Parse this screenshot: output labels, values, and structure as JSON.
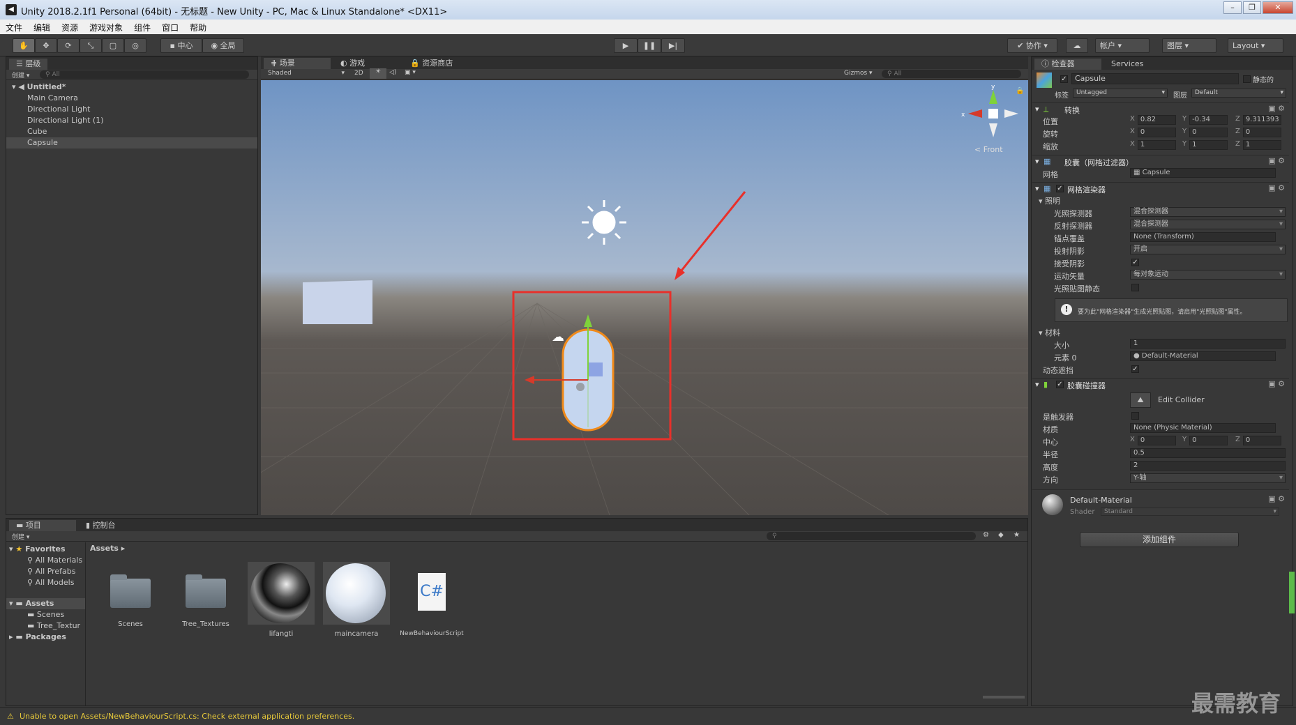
{
  "window": {
    "title": "Unity 2018.2.1f1 Personal (64bit) - 无标题 - New Unity - PC, Mac & Linux Standalone* <DX11>",
    "logo": "◀",
    "min": "–",
    "max": "❐",
    "close": "✕"
  },
  "menu": [
    "文件",
    "编辑",
    "资源",
    "游戏对象",
    "组件",
    "窗口",
    "帮助"
  ],
  "toolbar": {
    "center": "中心",
    "global": "全局",
    "collab": "协作",
    "account": "帐户",
    "layers": "图层",
    "layout": "Layout"
  },
  "hierarchy": {
    "tab": "层级",
    "create": "创建",
    "search": "All",
    "scene": "Untitled*",
    "items": [
      "Main Camera",
      "Directional Light",
      "Directional Light (1)",
      "Cube",
      "Capsule"
    ],
    "selected": 4
  },
  "sceneview": {
    "tabs": [
      "场景",
      "游戏",
      "资源商店"
    ],
    "shading": "Shaded",
    "mode2d": "2D",
    "gizmos": "Gizmos",
    "search": "All",
    "orientation": "Front"
  },
  "inspector": {
    "tabs": [
      "检查器",
      "Services"
    ],
    "object_name": "Capsule",
    "static": "静态的",
    "tag_label": "标签",
    "tag": "Untagged",
    "layer_label": "图层",
    "layer": "Default",
    "transform": {
      "title": "转换",
      "position": {
        "label": "位置",
        "x": "0.82",
        "y": "-0.34",
        "z": "9.311393"
      },
      "rotation": {
        "label": "旋转",
        "x": "0",
        "y": "0",
        "z": "0"
      },
      "scale": {
        "label": "缩放",
        "x": "1",
        "y": "1",
        "z": "1"
      }
    },
    "meshfilter": {
      "title": "胶囊（网格过滤器）",
      "mesh_label": "网格",
      "mesh": "Capsule"
    },
    "renderer": {
      "title": "网格渲染器",
      "lighting": "照明",
      "rows": [
        {
          "label": "光照探测器",
          "value": "混合探测器"
        },
        {
          "label": "反射探测器",
          "value": "混合探测器"
        },
        {
          "label": "锚点覆盖",
          "value": "None (Transform)"
        },
        {
          "label": "投射阴影",
          "value": "开启"
        }
      ],
      "receive": "接受阴影",
      "motion_label": "运动矢量",
      "motion": "每对象运动",
      "static_lightmap": "光照贴图静态",
      "info": "要为此\"网格渲染器\"生成光照贴图，请启用\"光照贴图\"属性。",
      "materials": "材料",
      "size_label": "大小",
      "size": "1",
      "element_label": "元素 0",
      "element": "Default-Material",
      "dynamic": "动态遮挡"
    },
    "collider": {
      "title": "胶囊碰撞器",
      "edit": "Edit Collider",
      "trigger": "是触发器",
      "material_label": "材质",
      "material": "None (Physic Material)",
      "center_label": "中心",
      "center": {
        "x": "0",
        "y": "0",
        "z": "0"
      },
      "radius_label": "半径",
      "radius": "0.5",
      "height_label": "高度",
      "height": "2",
      "direction_label": "方向",
      "direction": "Y-轴"
    },
    "material": {
      "name": "Default-Material",
      "shader_label": "Shader",
      "shader": "Standard"
    },
    "add_component": "添加组件"
  },
  "project": {
    "tabs": [
      "项目",
      "控制台"
    ],
    "create": "创建",
    "favorites": "Favorites",
    "fav_items": [
      "All Materials",
      "All Prefabs",
      "All Models"
    ],
    "assets": "Assets",
    "asset_children": [
      "Scenes",
      "Tree_Textur"
    ],
    "packages": "Packages",
    "breadcrumb": "Assets",
    "items": [
      {
        "name": "Scenes",
        "kind": "folder"
      },
      {
        "name": "Tree_Textures",
        "kind": "folder"
      },
      {
        "name": "lifangti",
        "kind": "mat-dark"
      },
      {
        "name": "maincamera",
        "kind": "mat-light"
      },
      {
        "name": "NewBehaviourScript",
        "kind": "script"
      }
    ]
  },
  "status": {
    "message": "Unable to open Assets/NewBehaviourScript.cs: Check external application preferences."
  },
  "watermark": "最需教育",
  "colors": {
    "highlight_box": "#e8302a",
    "arrow": "#e8302a",
    "capsule_outline": "#f08a1a"
  }
}
